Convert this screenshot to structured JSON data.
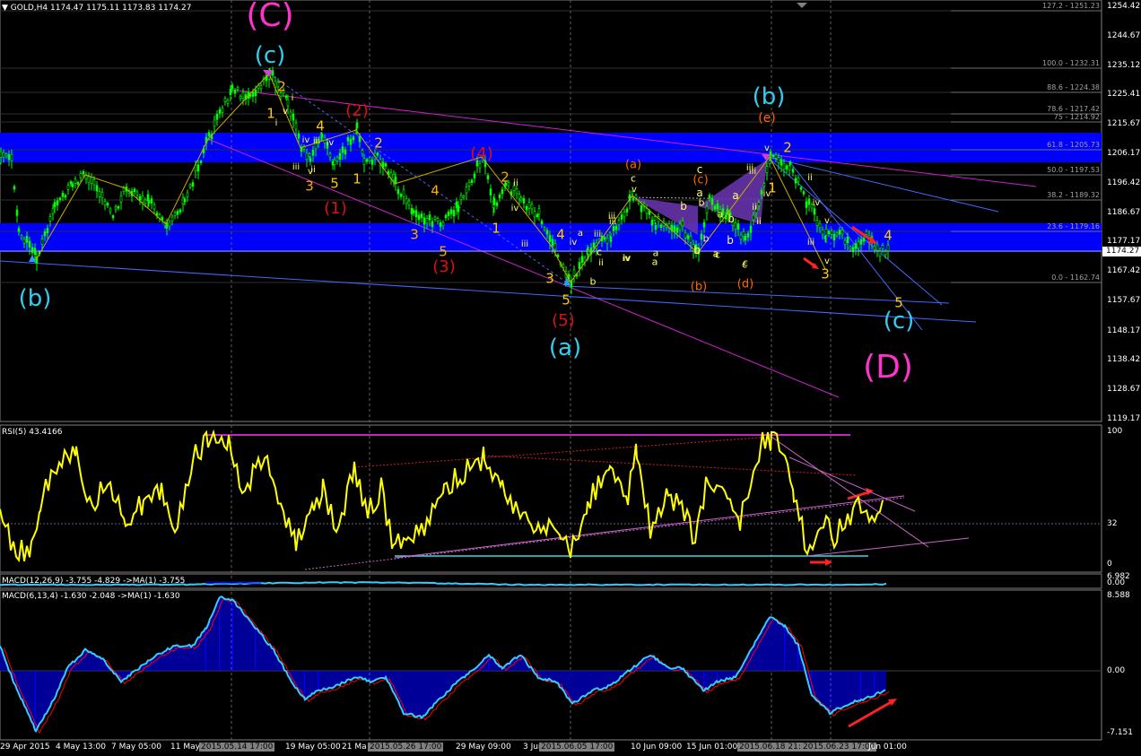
{
  "main_header": "GOLD,H4  1174.47 1175.11 1173.83 1174.27",
  "rsi_header": "RSI(5) 43.4166",
  "macd1_header": "MACD(12,26,9) -3.755 -4.829  ->MA(1) -3.755",
  "macd2_header": "MACD(6,13,4) -1.630 -2.048  ->MA(1) -1.630",
  "price_axis": [
    "1254.42",
    "1244.67",
    "1235.12",
    "1225.41",
    "1215.67",
    "1206.17",
    "1196.42",
    "1186.67",
    "1177.17",
    "1167.42",
    "1157.67",
    "1148.17",
    "1138.42",
    "1128.67",
    "1119.17"
  ],
  "current_price": "1174.27",
  "rsi_axis": [
    "100",
    "32",
    "0"
  ],
  "macd1_axis": [
    "6.982",
    "0.00"
  ],
  "macd2_axis": [
    "8.588",
    "0.00",
    "-7.151"
  ],
  "fib_labels": [
    "127.2 - 1251.23",
    "100.0 - 1232.31",
    "88.6 - 1224.38",
    "78.6 - 1217.42",
    "75 - 1214.92",
    "61.8 - 1205.73",
    "50.0 - 1197.53",
    "38.2 - 1189.32",
    "23.6 - 1179.16",
    "0.0 - 1162.74"
  ],
  "time_axis": [
    {
      "label": "29 Apr 2015",
      "hl": false
    },
    {
      "label": "4 May 13:00",
      "hl": false
    },
    {
      "label": "7 May 05:00",
      "hl": false
    },
    {
      "label": "11 May",
      "hl": false
    },
    {
      "label": "2015.05.14 17:00",
      "hl": true
    },
    {
      "label": "19 May 05:00",
      "hl": false
    },
    {
      "label": "21 Ma",
      "hl": false
    },
    {
      "label": "2015.05.26 17:00",
      "hl": true
    },
    {
      "label": "29 May 09:00",
      "hl": false
    },
    {
      "label": "3 Jun",
      "hl": false
    },
    {
      "label": "2015.06.05 17:00",
      "hl": true
    },
    {
      "label": "10 Jun 09:00",
      "hl": false
    },
    {
      "label": "15 Jun 01:00",
      "hl": false
    },
    {
      "label": "2015.06.18 21:00",
      "hl": true
    },
    {
      "label": "2015.06.23 17:00",
      "hl": true
    },
    {
      "label": "Jun 01:00",
      "hl": false
    }
  ],
  "wave_labels": [
    {
      "t": "(C)",
      "c": "#ff33cc",
      "s": 36
    },
    {
      "t": "(c)",
      "c": "#33ccee",
      "s": 26
    },
    {
      "t": "(b)",
      "c": "#33ccee",
      "s": 26
    },
    {
      "t": "(b)",
      "c": "#33ccee",
      "s": 26
    },
    {
      "t": "(e)",
      "c": "#ff6600",
      "s": 14
    },
    {
      "t": "(a)",
      "c": "#33ccee",
      "s": 26
    },
    {
      "t": "(c)",
      "c": "#33ccee",
      "s": 26
    },
    {
      "t": "(D)",
      "c": "#ff33cc",
      "s": 36
    },
    {
      "t": "(1)",
      "c": "#dd1111",
      "s": 18
    },
    {
      "t": "(2)",
      "c": "#dd1111",
      "s": 18
    },
    {
      "t": "(3)",
      "c": "#dd1111",
      "s": 18
    },
    {
      "t": "(4)",
      "c": "#dd1111",
      "s": 18
    },
    {
      "t": "(5)",
      "c": "#dd1111",
      "s": 18
    },
    {
      "t": "(a)",
      "c": "#ff6600",
      "s": 13
    },
    {
      "t": "(b)",
      "c": "#ff6600",
      "s": 13
    },
    {
      "t": "(c)",
      "c": "#ff6600",
      "s": 13
    },
    {
      "t": "(d)",
      "c": "#ff6600",
      "s": 13
    },
    {
      "t": "2",
      "c": "#ffaa00",
      "s": 15
    },
    {
      "t": "1",
      "c": "#ffcc00",
      "s": 15
    },
    {
      "t": "2",
      "c": "#ffcc00",
      "s": 15
    },
    {
      "t": "3",
      "c": "#ffaa00",
      "s": 15
    },
    {
      "t": "5",
      "c": "#ffcc00",
      "s": 15
    },
    {
      "t": "1",
      "c": "#ffcc00",
      "s": 15
    },
    {
      "t": "4",
      "c": "#ffcc00",
      "s": 15
    },
    {
      "t": "3",
      "c": "#ffaa00",
      "s": 15
    },
    {
      "t": "5",
      "c": "#ffaa00",
      "s": 15
    },
    {
      "t": "4",
      "c": "#ffaa00",
      "s": 15
    },
    {
      "t": "2",
      "c": "#ffaa00",
      "s": 15
    },
    {
      "t": "1",
      "c": "#ffcc00",
      "s": 15
    },
    {
      "t": "4",
      "c": "#ffcc00",
      "s": 15
    },
    {
      "t": "3",
      "c": "#ffcc00",
      "s": 15
    },
    {
      "t": "5",
      "c": "#ffcc00",
      "s": 15
    },
    {
      "t": "1",
      "c": "#ffcc00",
      "s": 15
    },
    {
      "t": "2",
      "c": "#ffcc00",
      "s": 15
    },
    {
      "t": "3",
      "c": "#ffcc00",
      "s": 15
    },
    {
      "t": "4",
      "c": "#ffcc00",
      "s": 15
    },
    {
      "t": "5",
      "c": "#ffcc00",
      "s": 15
    },
    {
      "t": "iii",
      "c": "#ffff66",
      "s": 10
    },
    {
      "t": "iv",
      "c": "#ffff66",
      "s": 10
    },
    {
      "t": "v",
      "c": "#ffff66",
      "s": 10
    },
    {
      "t": "iii",
      "c": "#ffff66",
      "s": 10
    },
    {
      "t": "iv",
      "c": "#ffff66",
      "s": 10
    },
    {
      "t": "ii",
      "c": "#ffff66",
      "s": 10
    },
    {
      "t": "iii",
      "c": "#ffff66",
      "s": 10
    },
    {
      "t": "iv",
      "c": "#ffff66",
      "s": 10
    },
    {
      "t": "a",
      "c": "#ffff66",
      "s": 10
    },
    {
      "t": "b",
      "c": "#ffff66",
      "s": 11
    },
    {
      "t": "c",
      "c": "#ffff66",
      "s": 11
    },
    {
      "t": "iii",
      "c": "#ffff66",
      "s": 10
    },
    {
      "t": "iv",
      "c": "#ffff66",
      "s": 10
    },
    {
      "t": "a",
      "c": "#ffff66",
      "s": 11
    },
    {
      "t": "b",
      "c": "#ffff66",
      "s": 12
    },
    {
      "t": "c",
      "c": "#ffff66",
      "s": 12
    },
    {
      "t": "a",
      "c": "#ffff66",
      "s": 12
    },
    {
      "t": "b",
      "c": "#ffff66",
      "s": 12
    },
    {
      "t": "c",
      "c": "#ffff66",
      "s": 11
    },
    {
      "t": "a",
      "c": "#ffff66",
      "s": 11
    },
    {
      "t": "b",
      "c": "#ffff66",
      "s": 12
    },
    {
      "t": "a",
      "c": "#ffff66",
      "s": 12
    },
    {
      "t": "b",
      "c": "#ffff66",
      "s": 12
    },
    {
      "t": "c",
      "c": "#ffff66",
      "s": 11
    },
    {
      "t": "iii",
      "c": "#ffff66",
      "s": 10
    },
    {
      "t": "iv",
      "c": "#ffff66",
      "s": 10
    },
    {
      "t": "ii",
      "c": "#ffff66",
      "s": 10
    },
    {
      "t": "iii",
      "c": "#ffff66",
      "s": 10
    },
    {
      "t": "iv",
      "c": "#ffff66",
      "s": 10
    },
    {
      "t": "v",
      "c": "#ffff66",
      "s": 10
    },
    {
      "t": "ii",
      "c": "#ffff66",
      "s": 10
    },
    {
      "t": "ii",
      "c": "#ffff66",
      "s": 10
    },
    {
      "t": "iii",
      "c": "#ffff66",
      "s": 10
    },
    {
      "t": "b",
      "c": "#ffff66",
      "s": 11
    },
    {
      "t": "iii",
      "c": "#ffff66",
      "s": 10
    },
    {
      "t": "v",
      "c": "#ffff66",
      "s": 10
    },
    {
      "t": "b",
      "c": "#ffff66",
      "s": 11
    },
    {
      "t": "a",
      "c": "#ffff66",
      "s": 11
    },
    {
      "t": "c",
      "c": "#ffff66",
      "s": 11
    },
    {
      "t": "v",
      "c": "#ffff66",
      "s": 10
    },
    {
      "t": "c",
      "c": "#ffff66",
      "s": 11
    },
    {
      "t": "a",
      "c": "#ffff66",
      "s": 11
    },
    {
      "t": "iv",
      "c": "#ffff66",
      "s": 10
    },
    {
      "t": "v",
      "c": "#ffff66",
      "s": 10
    },
    {
      "t": "ii",
      "c": "#ffff66",
      "s": 10
    },
    {
      "t": "iii",
      "c": "#ffff66",
      "s": 10
    },
    {
      "t": "iv",
      "c": "#ffff66",
      "s": 10
    },
    {
      "t": "v",
      "c": "#ffff66",
      "s": 10
    },
    {
      "t": "i",
      "c": "#ffff66",
      "s": 10
    },
    {
      "t": "i",
      "c": "#ffff66",
      "s": 10
    },
    {
      "t": "ii",
      "c": "#ffff66",
      "s": 10
    }
  ],
  "colors": {
    "background": "#000000",
    "fib_zone": "#0000ff",
    "candle": "#00ff00",
    "rsi_line": "#ffff00",
    "macd_line": "#33ccff",
    "macd_hist": "#0000ff",
    "signal": "#ff0000",
    "trendline": "#cc00cc",
    "channel": "#3366ff",
    "pattern": "#6633aa"
  }
}
